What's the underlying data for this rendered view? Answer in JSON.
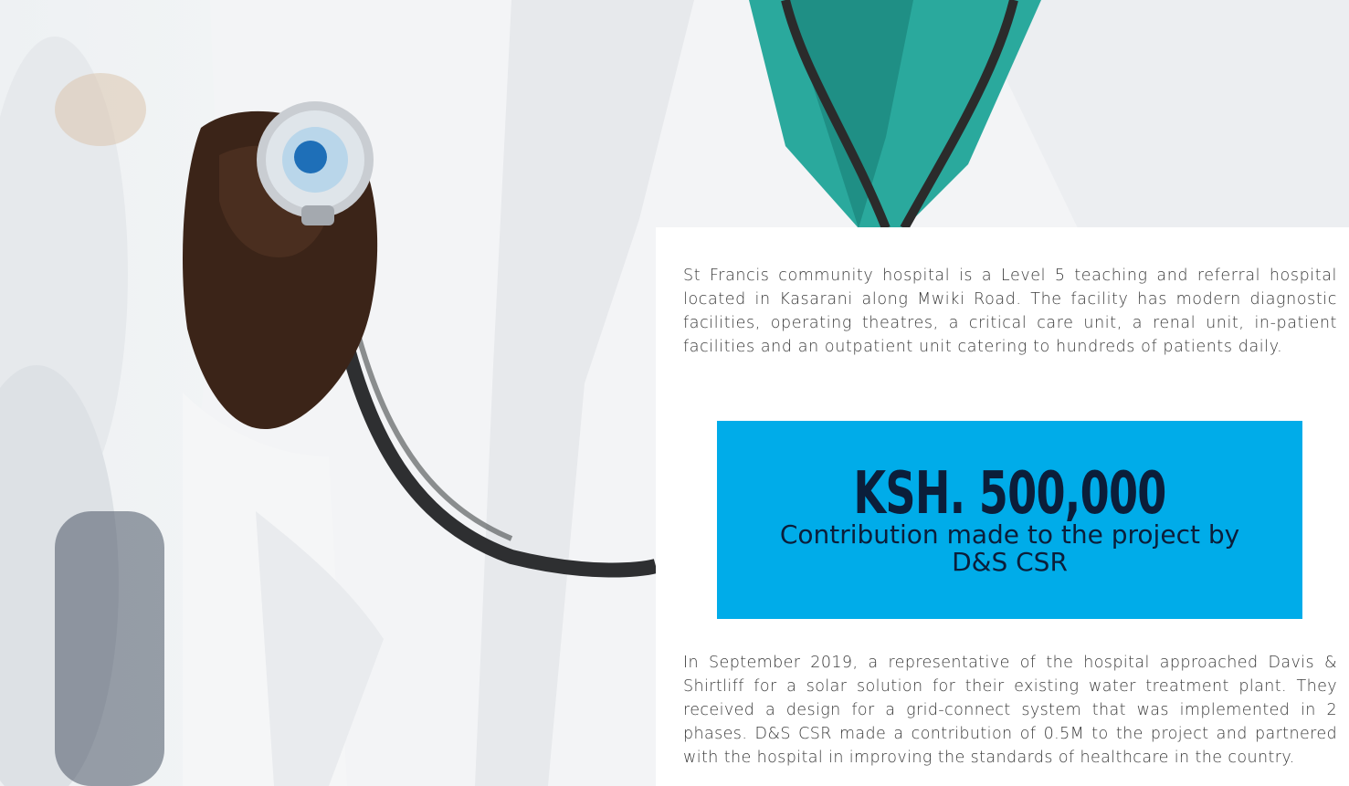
{
  "article": {
    "intro": "St Francis community hospital is a Level 5 teaching and referral hospital located in Kasarani along Mwiki Road. The facility has modern diagnostic facilities, operating theatres, a critical care unit, a renal unit, in-patient facilities and an outpatient unit catering to hundreds of patients daily.",
    "highlight": {
      "amount": "KSH. 500,000",
      "caption": "Contribution made to the project by D&S CSR"
    },
    "body": "In September 2019, a representative of the hospital approached Davis & Shirtliff for a solar solution for their existing water treatment plant. They received a design for a grid-connect system that was implemented in 2 phases. D&S CSR made a contribution of 0.5M to the project and partnered with the hospital in improving the standards of healthcare in the country."
  },
  "photo": {
    "subject": "doctor holding stethoscope"
  },
  "colors": {
    "highlight_background": "#00ace9",
    "highlight_text": "#0b1e3a",
    "body_text": "#3a3a3a"
  }
}
